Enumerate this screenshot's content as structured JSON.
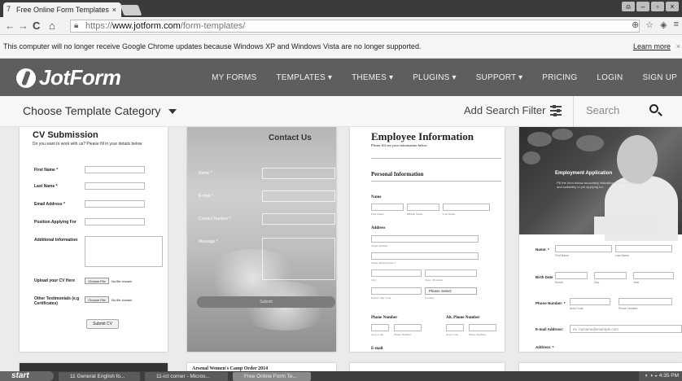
{
  "browser": {
    "tab_title": "Free Online Form Templates",
    "url_scheme": "https://",
    "url_host": "www.jotform.com",
    "url_path": "/form-templates/"
  },
  "notice": {
    "text": "This computer will no longer receive Google Chrome updates because Windows XP and Windows Vista are no longer supported.",
    "learn_more": "Learn more"
  },
  "header": {
    "logo": "JotForm",
    "nav": [
      {
        "label": "MY FORMS"
      },
      {
        "label": "TEMPLATES ▾"
      },
      {
        "label": "THEMES ▾"
      },
      {
        "label": "PLUGINS ▾"
      },
      {
        "label": "SUPPORT ▾"
      },
      {
        "label": "PRICING"
      },
      {
        "label": "LOGIN"
      },
      {
        "label": "SIGN UP"
      }
    ]
  },
  "filter": {
    "category": "Choose Template Category",
    "add_filter": "Add Search Filter",
    "search_placeholder": "Search"
  },
  "cards": {
    "cv": {
      "title": "CV Submission",
      "subtitle": "Do you want to work with us? Please fill in your details below",
      "fields": [
        "First Name *",
        "Last Name *",
        "Email Address *",
        "Position Applying For",
        "Additional Information"
      ],
      "upload_label": "Upload your CV Here",
      "testimonials_label": "Other Testimonials (e.g Certificates)",
      "choose_file": "Choose File",
      "no_file": "No file chosen",
      "submit": "Submit CV"
    },
    "contact": {
      "title": "Contact Us",
      "fields": [
        "Name *",
        "E-mail *",
        "Contact Number *",
        "Message *"
      ],
      "submit": "Submit"
    },
    "employee": {
      "title": "Employee Information",
      "subtitle": "Please fill out your information below.",
      "section": "Personal Information",
      "name_label": "Name",
      "name_sub": [
        "First Name",
        "Middle Name",
        "Last Name"
      ],
      "address_label": "Address",
      "address_sub": [
        "Street Address",
        "Street Address Line 2",
        "City",
        "State / Province",
        "Postal / Zip Code",
        "Country"
      ],
      "select": "Please Select",
      "phone_label": "Phone Number",
      "alt_phone_label": "Alt. Phone Number",
      "phone_sub": [
        "Area Code",
        "Phone Number"
      ],
      "email_label": "E-mail"
    },
    "employment": {
      "banner_title": "Employment Application",
      "banner_sub": "Fill the form below accurately indicating your potentials and suitability to job applying for.",
      "name_label": "Name: *",
      "name_sub": [
        "First Name",
        "Last Name"
      ],
      "birth_label": "Birth Date",
      "birth_sub": [
        "Month",
        "Day",
        "Year"
      ],
      "phone_label": "Phone Number: *",
      "phone_sub": [
        "Area Code",
        "Phone Number"
      ],
      "email_label": "E-mail Address:",
      "email_placeholder": "ex: myname@example.com",
      "address_label": "Address: *"
    },
    "next_title": "Arsenal Women's Camp Order 2014"
  },
  "taskbar": {
    "start": "start",
    "tasks": [
      "11 General English fo...",
      "11-ict corner - Micros...",
      "Free Online Form Te..."
    ],
    "time": "4:35 PM"
  }
}
